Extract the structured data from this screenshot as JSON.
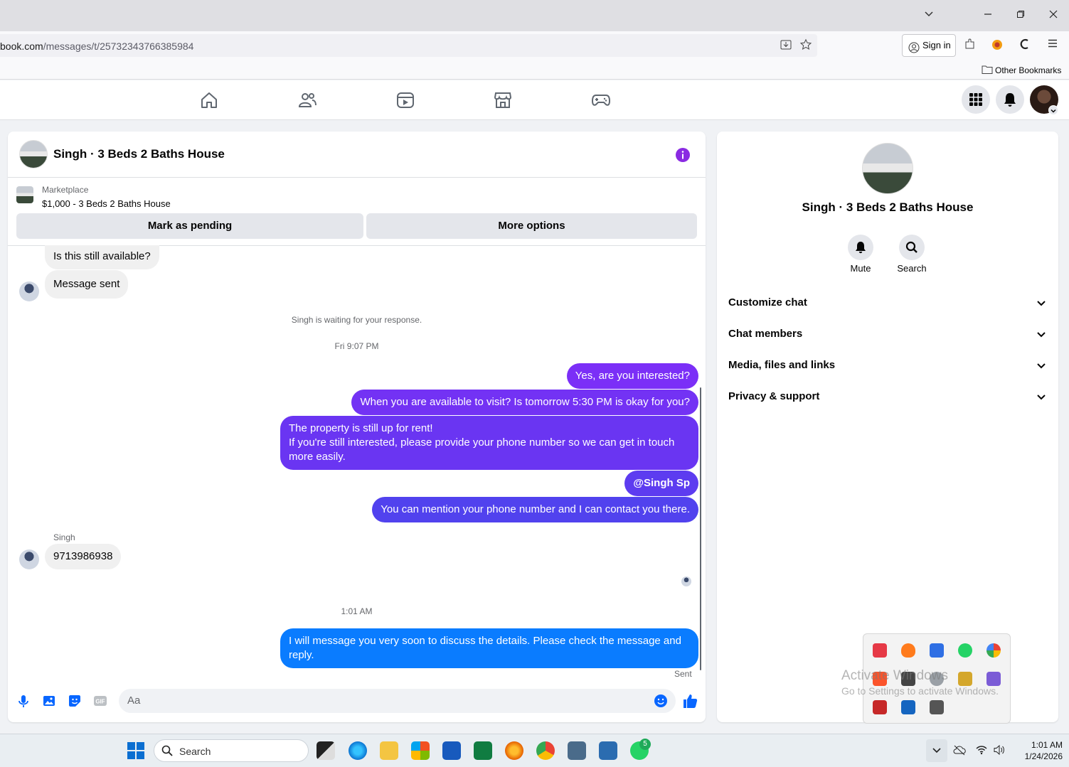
{
  "browser": {
    "url_main": "book.com",
    "url_path": "/messages/t/25732343766385984",
    "signin_label": "Sign in",
    "bookmarks_label": "Other Bookmarks"
  },
  "conversation": {
    "title": "Singh · 3 Beds 2 Baths House",
    "listing_source": "Marketplace",
    "listing_title": "$1,000 - 3 Beds 2 Baths House",
    "mark_pending_label": "Mark as pending",
    "more_options_label": "More options"
  },
  "messages": {
    "in1": "Is this still available?",
    "in2": "Message sent",
    "waiting_note": "Singh is waiting for your response.",
    "time1": "Fri 9:07 PM",
    "out1": "Yes, are you interested?",
    "out2": "When you are available to visit? Is tomorrow 5:30 PM is okay for you?",
    "out3_line1": "The property is still up for rent!",
    "out3_line2": "If you're still interested, please provide your phone number so we can get in touch more easily.",
    "out4": "@Singh Sp",
    "out5": "You can mention your phone number and I can contact you there.",
    "sender_name": "Singh",
    "in3": "9713986938",
    "time2": "1:01 AM",
    "out6": "I will message you very soon to discuss the details. Please check the message and reply.",
    "status": "Sent"
  },
  "composer": {
    "placeholder": "Aa"
  },
  "info_panel": {
    "name": "Singh · 3 Beds 2 Baths House",
    "mute_label": "Mute",
    "search_label": "Search",
    "sections": [
      "Customize chat",
      "Chat members",
      "Media, files and links",
      "Privacy & support"
    ]
  },
  "watermark": {
    "line1": "Activate Windows",
    "line2": "Go to Settings to activate Windows."
  },
  "taskbar": {
    "search_label": "Search",
    "whatsapp_badge": "5",
    "time": "1:01 AM",
    "date": "1/24/2026"
  },
  "colors": {
    "accent_purple": "#8a2be2",
    "bubble_gradient_top": "#7b2ff7",
    "bubble_blue": "#0a7cff",
    "fb_blue": "#0866ff"
  }
}
